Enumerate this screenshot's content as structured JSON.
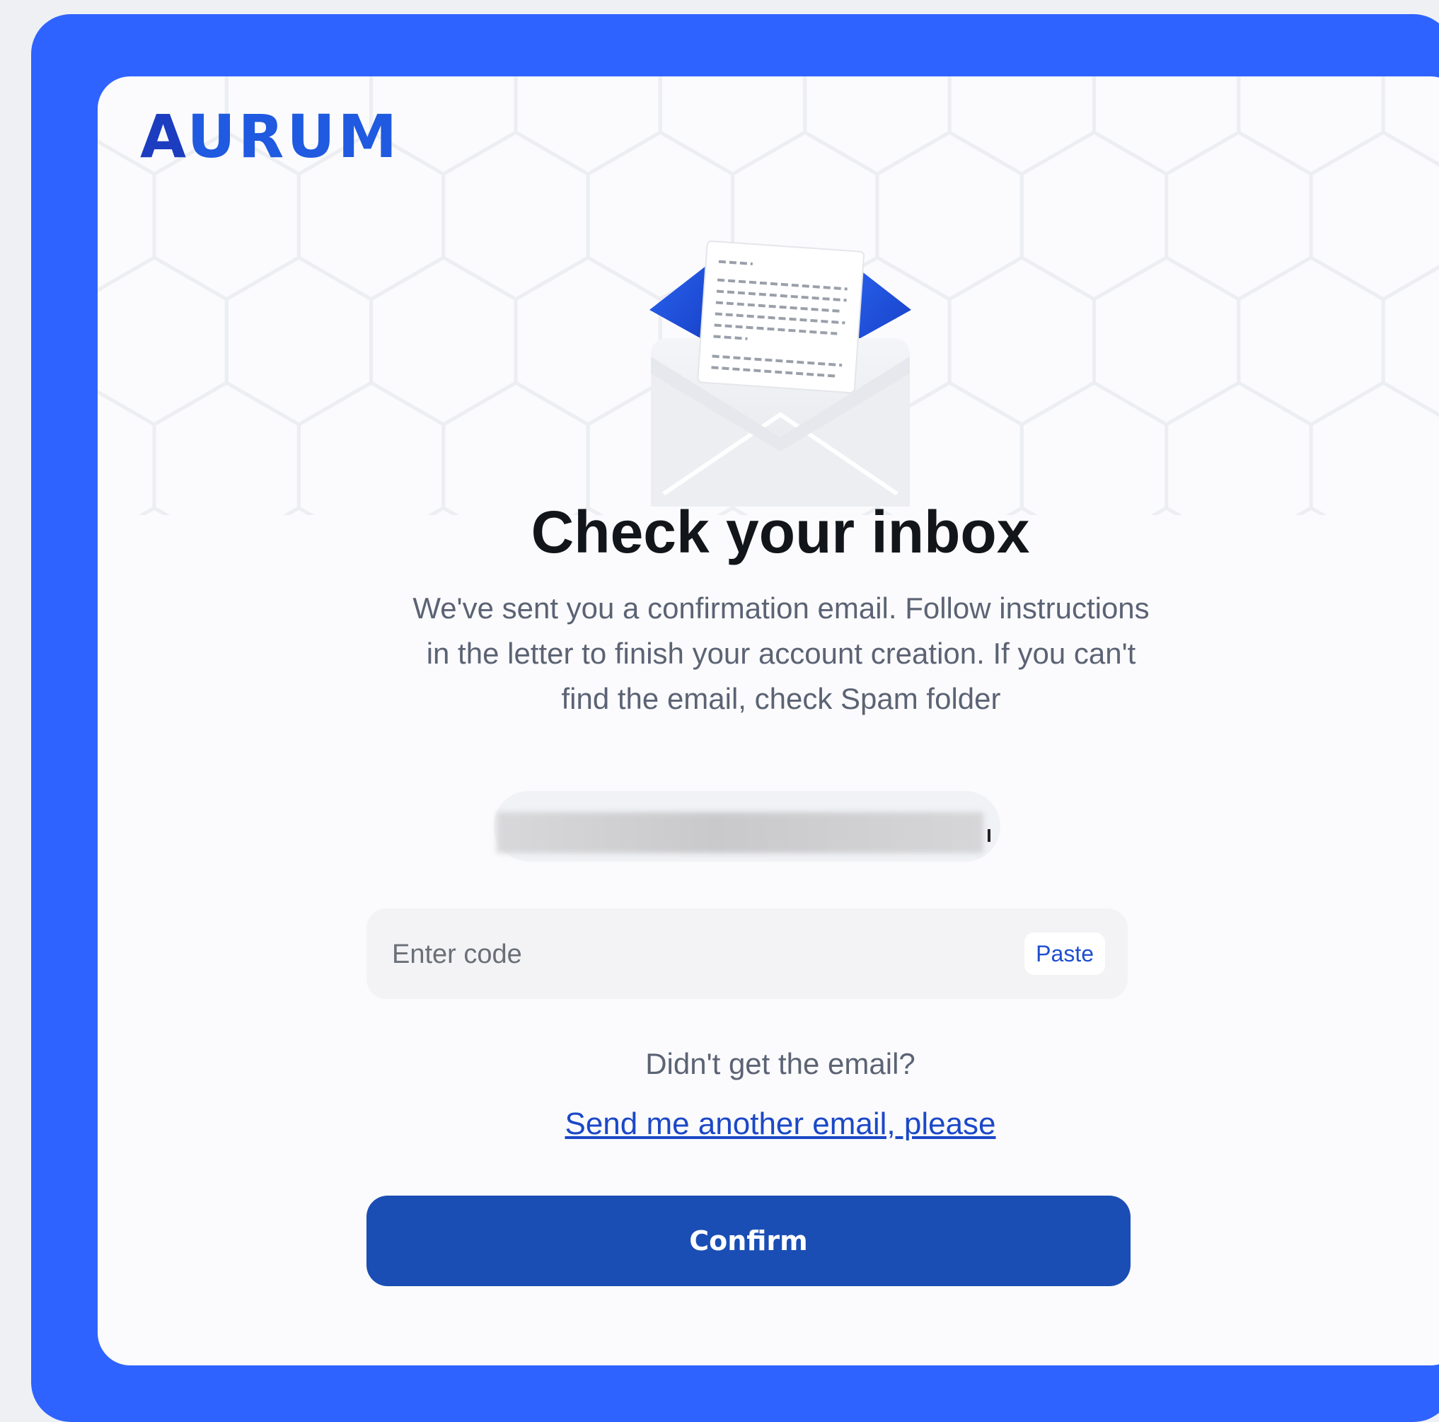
{
  "brand": {
    "logo_text": "AURUM",
    "logo_first_letter": "A",
    "logo_rest": "URUM",
    "primary_color": "#2f63ff",
    "button_color": "#1a4eb4",
    "link_color": "#1c48c7"
  },
  "illustration": {
    "icon": "open-envelope-with-letter-icon"
  },
  "verify": {
    "title": "Check your inbox",
    "description": "We've sent you a confirmation email. Follow instructions in the letter to finish your account creation. If you can't find the email, check Spam folder",
    "email": "",
    "code_input": {
      "value": "",
      "placeholder": "Enter code"
    },
    "paste_label": "Paste",
    "resend_question": "Didn't get the email?",
    "resend_link": "Send me another email, please",
    "confirm_label": "Confirm"
  }
}
